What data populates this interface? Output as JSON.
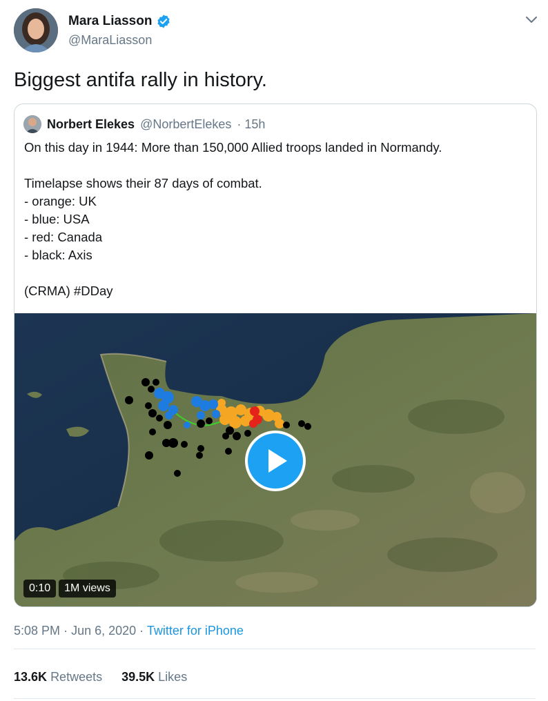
{
  "tweet": {
    "author_name": "Mara Liasson",
    "author_handle": "@MaraLiasson",
    "text": "Biggest antifa rally in history.",
    "time": "5:08 PM",
    "date": "Jun 6, 2020",
    "source": "Twitter for iPhone",
    "separator": "·"
  },
  "quoted": {
    "name": "Norbert Elekes",
    "handle": "@NorbertElekes",
    "age": "· 15h",
    "lines": [
      "On this day in 1944: More than 150,000 Allied troops landed in Normandy.",
      "",
      "Timelapse shows their 87 days of combat.",
      "- orange: UK",
      "- blue: USA",
      "- red: Canada",
      "- black: Axis",
      "",
      "(CRMA) #DDay"
    ]
  },
  "video": {
    "duration": "0:10",
    "views": "1M views"
  },
  "stats": {
    "retweets_count": "13.6K",
    "retweets_label": "Retweets",
    "likes_count": "39.5K",
    "likes_label": "Likes"
  },
  "colors": {
    "accent": "#1da1f2",
    "link": "#1b95e0",
    "uk_orange": "#f5a623",
    "usa_blue": "#1e7be0",
    "canada_red": "#e4241b",
    "axis_black": "#000000"
  },
  "icons": {
    "verified": "verified-badge-icon",
    "caret": "chevron-down-icon",
    "play": "play-icon"
  }
}
